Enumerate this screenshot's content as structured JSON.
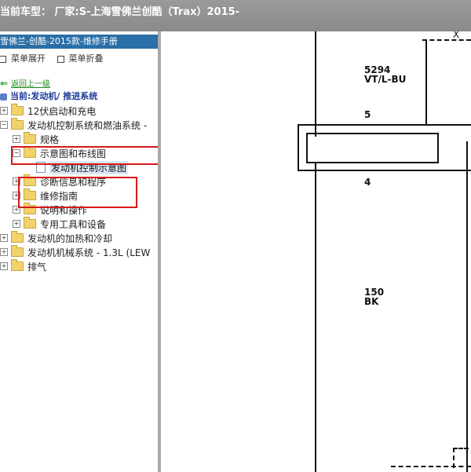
{
  "title_bar": {
    "text": "当前车型： 厂家:S-上海雪佛兰创酷（Trax）2015-"
  },
  "left_panel": {
    "header": "雪佛兰-创酷-2015款-维修手册",
    "menu": {
      "expand_label": "菜单展开",
      "collapse_label": "菜单折叠"
    },
    "back_link": "返回上一级",
    "current_location": "当前:发动机/ 推进系统",
    "tree_items": [
      {
        "label": "12伏启动和充电"
      },
      {
        "label": "发动机控制系统和燃油系统 -"
      },
      {
        "label": "规格"
      },
      {
        "label": "示意图和布线图"
      },
      {
        "label": "发动机控制示意图"
      },
      {
        "label": "诊断信息和程序"
      },
      {
        "label": "维修指南"
      },
      {
        "label": "说明和操作"
      },
      {
        "label": "专用工具和设备"
      },
      {
        "label": "发动机的加热和冷却"
      },
      {
        "label": "发动机机械系统 - 1.3L (LEW"
      },
      {
        "label": "排气"
      }
    ]
  },
  "diagram": {
    "wire_top_id": "5294",
    "wire_top_color": "VT/L-BU",
    "pin_top": "5",
    "pin_bottom": "4",
    "wire_bottom_id": "150",
    "wire_bottom_color": "BK",
    "corner_fragment": "X"
  }
}
